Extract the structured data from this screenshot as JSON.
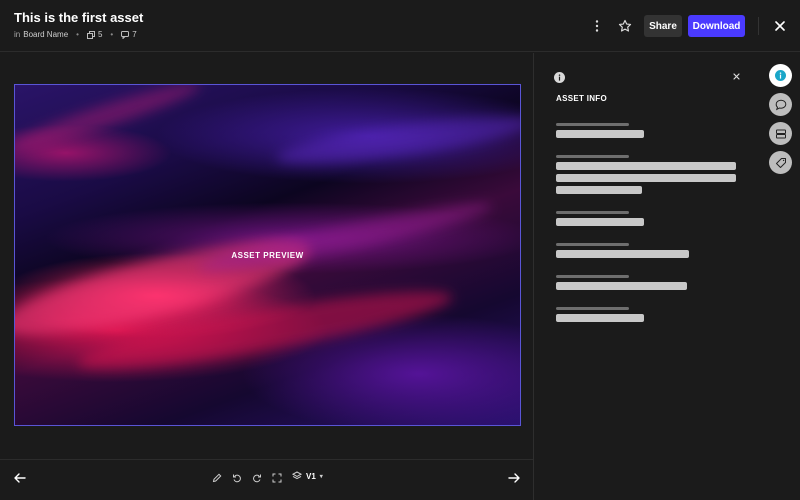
{
  "header": {
    "title": "This is the first asset",
    "in_label": "in",
    "board_name": "Board Name",
    "separator": "•",
    "files_count": "5",
    "comments_count": "7",
    "share_label": "Share",
    "download_label": "Download"
  },
  "viewer": {
    "preview_label": "ASSET PREVIEW",
    "version_label": "V1",
    "version_caret": "▾"
  },
  "panel": {
    "title": "ASSET INFO",
    "fields": [
      {
        "label_fraction": 0.27,
        "value_lines": [
          0.49
        ]
      },
      {
        "label_fraction": 0.27,
        "value_lines": [
          1.0,
          1.0,
          0.48
        ]
      },
      {
        "label_fraction": 0.27,
        "value_lines": [
          0.49
        ]
      },
      {
        "label_fraction": 0.27,
        "value_lines": [
          0.74
        ]
      },
      {
        "label_fraction": 0.27,
        "value_lines": [
          0.73
        ]
      },
      {
        "label_fraction": 0.27,
        "value_lines": [
          0.49
        ]
      }
    ]
  },
  "colors": {
    "background": "#1b1b1b",
    "accent": "#4a3aff",
    "rail_active_icon": "#1aa6c8"
  },
  "icons": [
    "more-vertical-icon",
    "star-icon",
    "close-icon",
    "info-icon",
    "comment-icon",
    "storage-icon",
    "tag-icon",
    "arrow-left-icon",
    "arrow-right-icon",
    "pencil-icon",
    "rotate-left-icon",
    "rotate-right-icon",
    "fullscreen-icon",
    "layers-icon",
    "files-icon",
    "comments-icon"
  ]
}
